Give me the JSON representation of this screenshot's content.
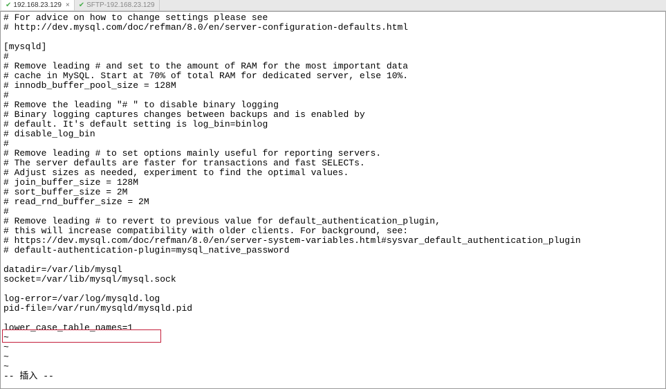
{
  "tabs": [
    {
      "label": "192.168.23.129",
      "active": true
    },
    {
      "label": "SFTP-192.168.23.129",
      "active": false
    }
  ],
  "file_lines": [
    "# For advice on how to change settings please see",
    "# http://dev.mysql.com/doc/refman/8.0/en/server-configuration-defaults.html",
    "",
    "[mysqld]",
    "#",
    "# Remove leading # and set to the amount of RAM for the most important data",
    "# cache in MySQL. Start at 70% of total RAM for dedicated server, else 10%.",
    "# innodb_buffer_pool_size = 128M",
    "#",
    "# Remove the leading \"# \" to disable binary logging",
    "# Binary logging captures changes between backups and is enabled by",
    "# default. It's default setting is log_bin=binlog",
    "# disable_log_bin",
    "#",
    "# Remove leading # to set options mainly useful for reporting servers.",
    "# The server defaults are faster for transactions and fast SELECTs.",
    "# Adjust sizes as needed, experiment to find the optimal values.",
    "# join_buffer_size = 128M",
    "# sort_buffer_size = 2M",
    "# read_rnd_buffer_size = 2M",
    "#",
    "# Remove leading # to revert to previous value for default_authentication_plugin,",
    "# this will increase compatibility with older clients. For background, see:",
    "# https://dev.mysql.com/doc/refman/8.0/en/server-system-variables.html#sysvar_default_authentication_plugin",
    "# default-authentication-plugin=mysql_native_password",
    "",
    "datadir=/var/lib/mysql",
    "socket=/var/lib/mysql/mysql.sock",
    "",
    "log-error=/var/log/mysqld.log",
    "pid-file=/var/run/mysqld/mysqld.pid",
    "",
    "lower_case_table_names=1"
  ],
  "tilde_lines": [
    "~",
    "~",
    "~",
    "~"
  ],
  "status_line": "-- 插入 --"
}
